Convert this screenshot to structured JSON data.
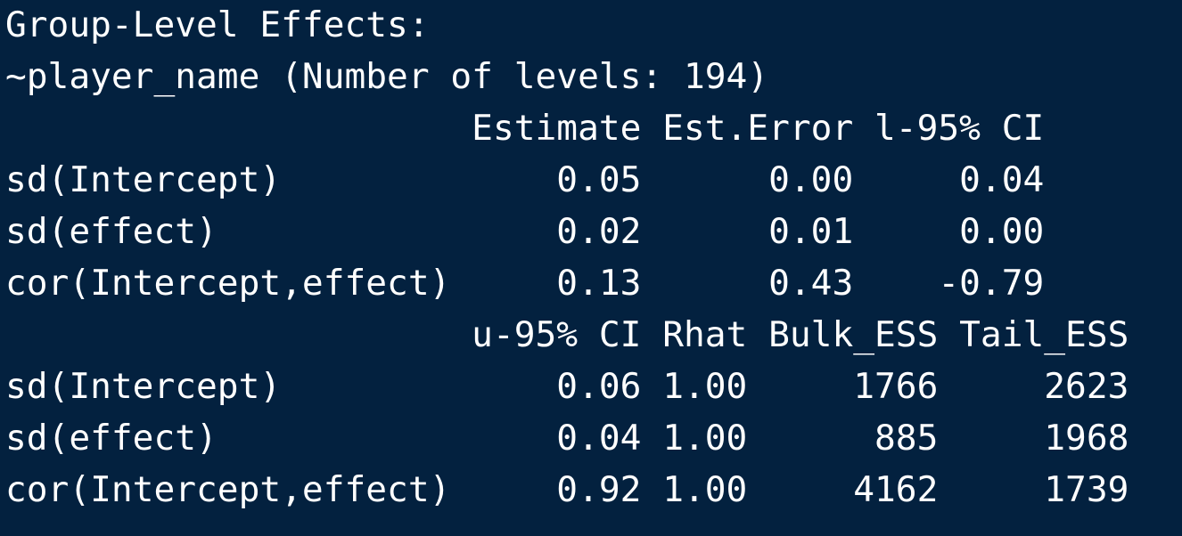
{
  "colors": {
    "background": "#03213f",
    "text": "#ffffff"
  },
  "lines": [
    "Group-Level Effects:",
    "~player_name (Number of levels: 194)",
    "                      Estimate Est.Error l-95% CI",
    "sd(Intercept)             0.05      0.00     0.04",
    "sd(effect)                0.02      0.01     0.00",
    "cor(Intercept,effect)     0.13      0.43    -0.79",
    "                      u-95% CI Rhat Bulk_ESS Tail_ESS",
    "sd(Intercept)             0.06 1.00     1766     2623",
    "sd(effect)                0.04 1.00      885     1968",
    "cor(Intercept,effect)     0.92 1.00     4162     1739"
  ]
}
